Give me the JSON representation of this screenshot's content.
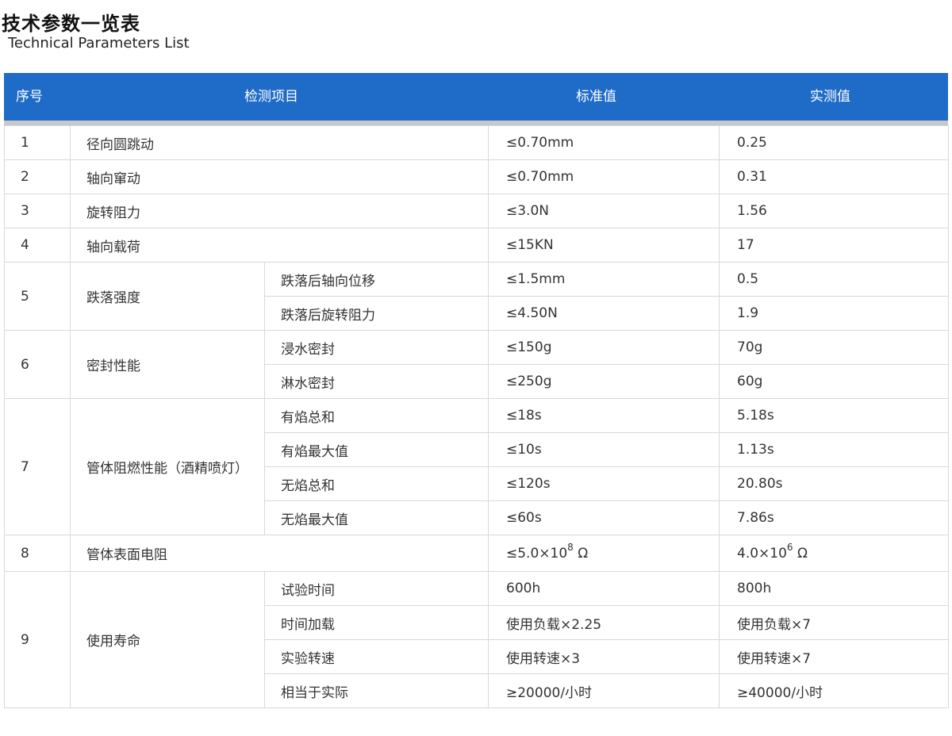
{
  "title": "技术参数一览表",
  "subtitle": "Technical Parameters List",
  "table": {
    "headers": {
      "seq": "序号",
      "item": "检测项目",
      "standard": "标准值",
      "actual": "实测值"
    },
    "rows": [
      {
        "seq": "1",
        "item": "径向圆跳动",
        "standard": "≤0.70mm",
        "actual": "0.25"
      },
      {
        "seq": "2",
        "item": "轴向窜动",
        "standard": "≤0.70mm",
        "actual": "0.31"
      },
      {
        "seq": "3",
        "item": "旋转阻力",
        "standard": "≤3.0N",
        "actual": "1.56"
      },
      {
        "seq": "4",
        "item": "轴向载荷",
        "standard": "≤15KN",
        "actual": "17"
      },
      {
        "seq": "5",
        "item": "跌落强度",
        "sub": [
          {
            "name": "跌落后轴向位移",
            "standard": "≤1.5mm",
            "actual": "0.5"
          },
          {
            "name": "跌落后旋转阻力",
            "standard": "≤4.50N",
            "actual": "1.9"
          }
        ]
      },
      {
        "seq": "6",
        "item": "密封性能",
        "sub": [
          {
            "name": "浸水密封",
            "standard": "≤150g",
            "actual": "70g"
          },
          {
            "name": "淋水密封",
            "standard": "≤250g",
            "actual": "60g"
          }
        ]
      },
      {
        "seq": "7",
        "item": "管体阻燃性能（酒精喷灯）",
        "sub": [
          {
            "name": "有焰总和",
            "standard": "≤18s",
            "actual": "5.18s"
          },
          {
            "name": "有焰最大值",
            "standard": "≤10s",
            "actual": "1.13s"
          },
          {
            "name": "无焰总和",
            "standard": "≤120s",
            "actual": "20.80s"
          },
          {
            "name": "无焰最大值",
            "standard": "≤60s",
            "actual": "7.86s"
          }
        ]
      },
      {
        "seq": "8",
        "item": "管体表面电阻",
        "standard_base": "≤5.0×10",
        "standard_exp": "8",
        "standard_unit": " Ω",
        "actual_base": "4.0×10",
        "actual_exp": "6",
        "actual_unit": " Ω"
      },
      {
        "seq": "9",
        "item": "使用寿命",
        "sub": [
          {
            "name": "试验时间",
            "standard": "600h",
            "actual": "800h"
          },
          {
            "name": "时间加载",
            "standard": "使用负载×2.25",
            "actual": "使用负载×7"
          },
          {
            "name": "实验转速",
            "standard": "使用转速×3",
            "actual": "使用转速×7"
          },
          {
            "name": "相当于实际",
            "standard": "≥20000/小时",
            "actual": "≥40000/小时"
          }
        ]
      }
    ]
  },
  "colors": {
    "header_bg": "#1f6bc8",
    "header_text": "#ffffff",
    "border": "#d9d9d9"
  }
}
